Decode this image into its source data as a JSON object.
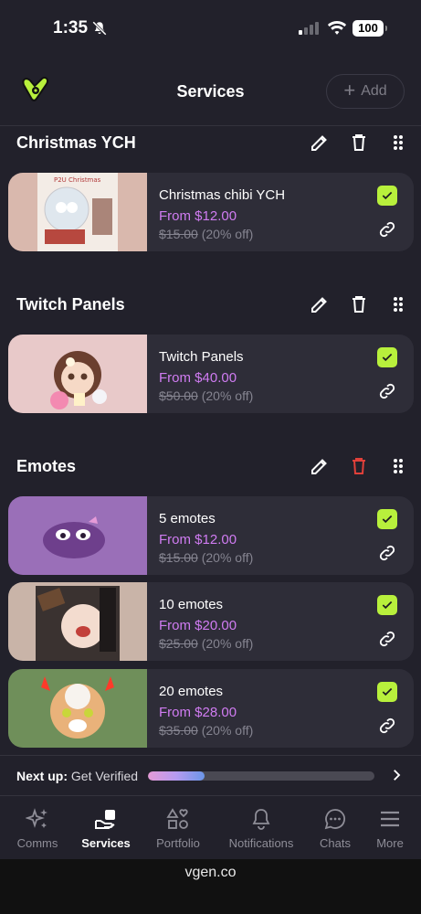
{
  "status": {
    "time": "1:35",
    "battery": "100"
  },
  "header": {
    "title": "Services",
    "add_label": "Add"
  },
  "sections": [
    {
      "title": "Christmas YCH",
      "delete_color": "#ffffff",
      "items": [
        {
          "name": "Christmas chibi YCH",
          "price": "From $12.00",
          "old_price": "$15.00",
          "discount": "(20% off)",
          "enabled": true
        }
      ]
    },
    {
      "title": "Twitch Panels",
      "delete_color": "#ffffff",
      "items": [
        {
          "name": "Twitch Panels",
          "price": "From $40.00",
          "old_price": "$50.00",
          "discount": "(20% off)",
          "enabled": true
        }
      ]
    },
    {
      "title": "Emotes",
      "delete_color": "#e0403a",
      "items": [
        {
          "name": "5 emotes",
          "price": "From $12.00",
          "old_price": "$15.00",
          "discount": "(20% off)",
          "enabled": true
        },
        {
          "name": "10 emotes",
          "price": "From $20.00",
          "old_price": "$25.00",
          "discount": "(20% off)",
          "enabled": true
        },
        {
          "name": "20 emotes",
          "price": "From $28.00",
          "old_price": "$35.00",
          "discount": "(20% off)",
          "enabled": true
        }
      ]
    }
  ],
  "next_up": {
    "label": "Next up:",
    "task": "Get Verified",
    "progress": 0.25
  },
  "tabs": [
    {
      "label": "Comms",
      "icon": "sparkles-icon",
      "active": false
    },
    {
      "label": "Services",
      "icon": "services-hand-icon",
      "active": true
    },
    {
      "label": "Portfolio",
      "icon": "portfolio-shapes-icon",
      "active": false
    },
    {
      "label": "Notifications",
      "icon": "bell-icon",
      "active": false
    },
    {
      "label": "Chats",
      "icon": "chat-bubble-icon",
      "active": false
    },
    {
      "label": "More",
      "icon": "hamburger-menu-icon",
      "active": false
    }
  ],
  "browser": {
    "url": "vgen.co"
  },
  "colors": {
    "accent_check": "#b8f03c",
    "price": "#d07cf2",
    "background": "#22212b",
    "card": "#2e2d38",
    "delete_active": "#e0403a"
  }
}
